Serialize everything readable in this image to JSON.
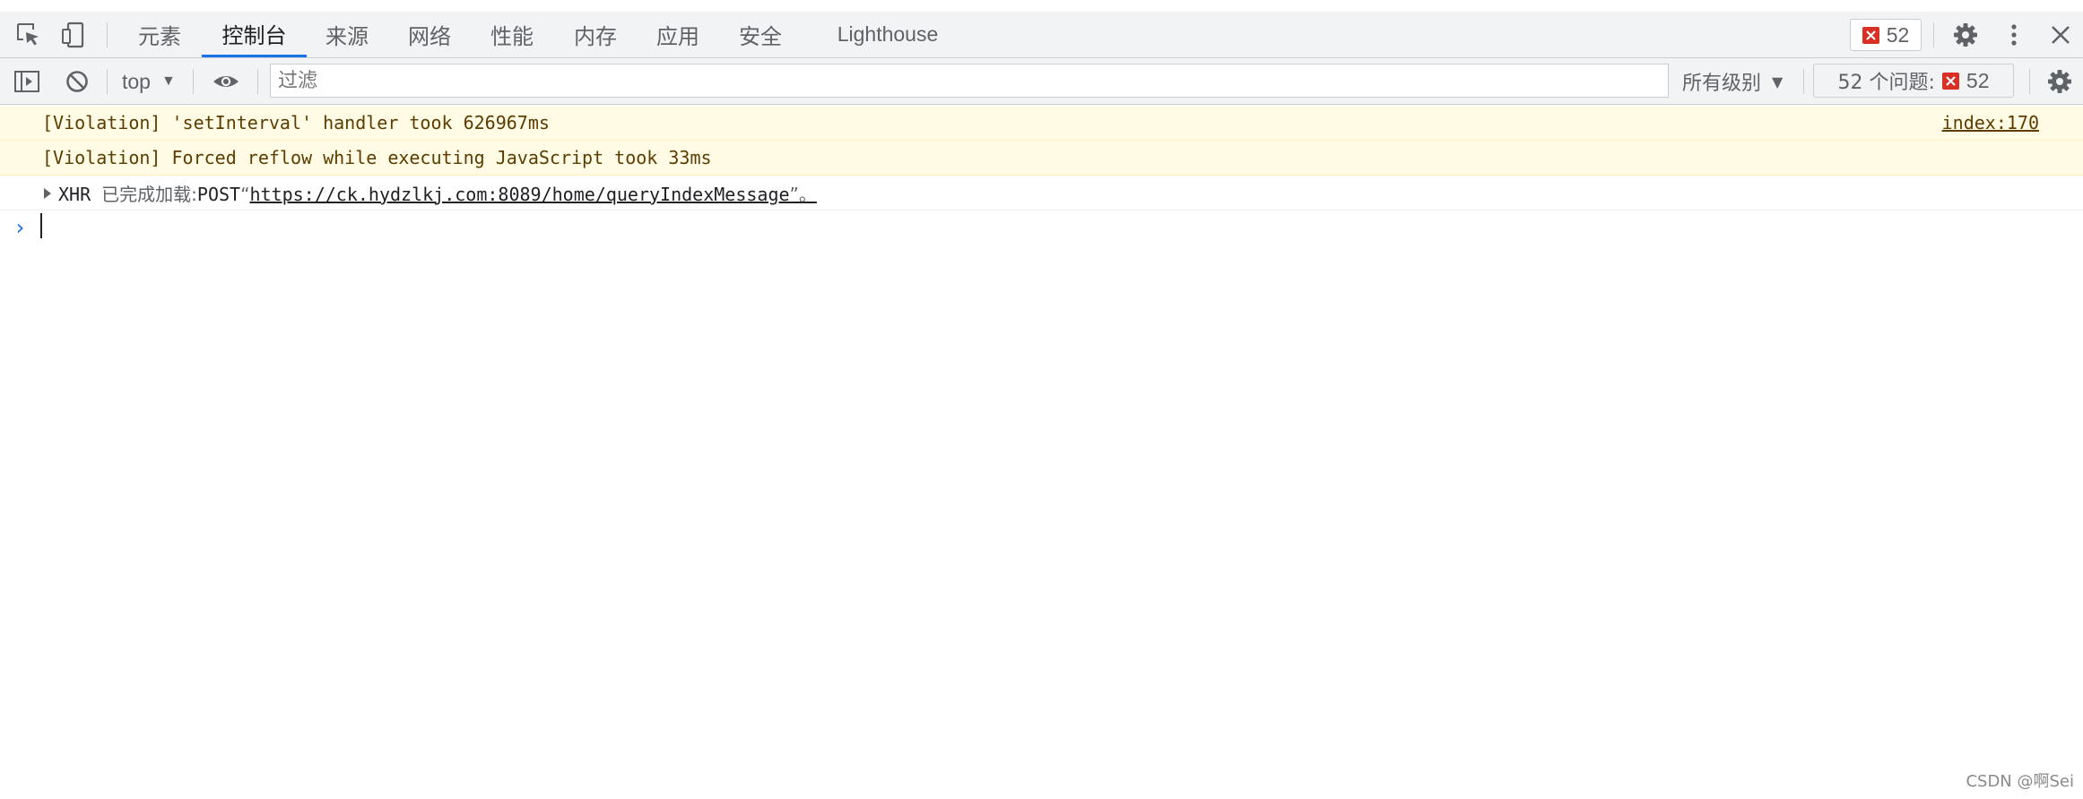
{
  "tabs": [
    {
      "label": "元素",
      "active": false
    },
    {
      "label": "控制台",
      "active": true
    },
    {
      "label": "来源",
      "active": false
    },
    {
      "label": "网络",
      "active": false
    },
    {
      "label": "性能",
      "active": false
    },
    {
      "label": "内存",
      "active": false
    },
    {
      "label": "应用",
      "active": false
    },
    {
      "label": "安全",
      "active": false
    },
    {
      "label": "Lighthouse",
      "active": false
    }
  ],
  "error_count": "52",
  "toolbar": {
    "context_label": "top",
    "filter_placeholder": "过滤",
    "levels_label": "所有级别",
    "issues_label": "52 个问题:",
    "issues_count": "52"
  },
  "messages": [
    {
      "level": "warning",
      "text": "[Violation] 'setInterval' handler took 626967ms",
      "source": "index:170"
    },
    {
      "level": "warning",
      "text": "[Violation] Forced reflow while executing JavaScript took 33ms",
      "source": ""
    },
    {
      "level": "info",
      "type_label": "XHR",
      "status_text": "已完成加载:",
      "method": "POST",
      "open_quote": "“",
      "url": "https://ck.hydzlkj.com:8089/home/queryIndexMessage",
      "close_quote": "”。"
    }
  ],
  "prompt_symbol": "›",
  "watermark": "CSDN @啊Sei",
  "colors": {
    "accent": "#1a73e8",
    "error": "#d93025",
    "warning_bg": "#fffbe5",
    "warning_text": "#5c3c00",
    "toolbar_bg": "#f1f3f4"
  },
  "icons": [
    "inspect-element-icon",
    "device-toggle-icon",
    "sidebar-toggle-icon",
    "clear-console-icon",
    "eye-icon",
    "settings-icon",
    "more-vert-icon",
    "close-icon",
    "console-settings-icon"
  ]
}
